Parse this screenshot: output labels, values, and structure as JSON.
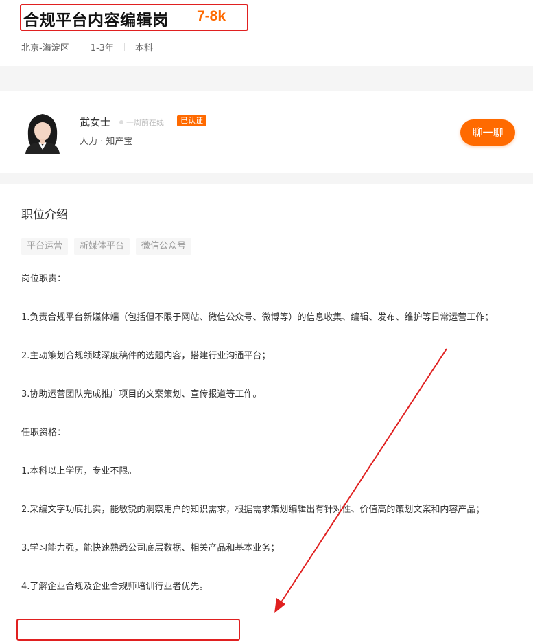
{
  "job": {
    "title": "合规平台内容编辑岗",
    "salary": "7-8k",
    "location": "北京-海淀区",
    "experience": "1-3年",
    "education": "本科"
  },
  "recruiter": {
    "name": "武女士",
    "online_status": "一周前在线",
    "verified_badge": "已认证",
    "company": "人力 · 知产宝",
    "chat_button": "聊一聊"
  },
  "description": {
    "section_title": "职位介绍",
    "tags": [
      "平台运营",
      "新媒体平台",
      "微信公众号"
    ],
    "paragraphs": [
      "岗位职责：",
      "1.负责合规平台新媒体端（包括但不限于网站、微信公众号、微博等）的信息收集、编辑、发布、维护等日常运营工作；",
      "2.主动策划合规领域深度稿件的选题内容，搭建行业沟通平台；",
      "3.协助运营团队完成推广项目的文案策划、宣传报道等工作。",
      "任职资格：",
      "1.本科以上学历，专业不限。",
      "2.采编文字功底扎实，能敏锐的洞察用户的知识需求，根据需求策划编辑出有针对性、价值高的策划文案和内容产品；",
      "3.学习能力强，能快速熟悉公司底层数据、相关产品和基本业务；",
      "4.了解企业合规及企业合规师培训行业者优先。"
    ]
  },
  "colors": {
    "accent": "#ff6a00",
    "annotation": "#e02020"
  }
}
